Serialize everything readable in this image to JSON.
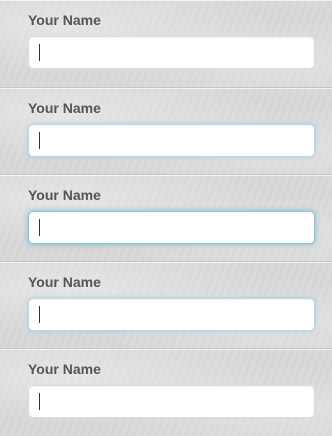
{
  "form": {
    "fields": [
      {
        "label": "Your Name",
        "value": "",
        "placeholder": ""
      },
      {
        "label": "Your Name",
        "value": "",
        "placeholder": ""
      },
      {
        "label": "Your Name",
        "value": "",
        "placeholder": ""
      },
      {
        "label": "Your Name",
        "value": "",
        "placeholder": ""
      },
      {
        "label": "Your Name",
        "value": "",
        "placeholder": ""
      }
    ]
  },
  "colors": {
    "panel_background": "#d8d8d8",
    "label_text": "#555555",
    "field_background": "#ffffff",
    "focus_glow": "#8ec6de"
  }
}
